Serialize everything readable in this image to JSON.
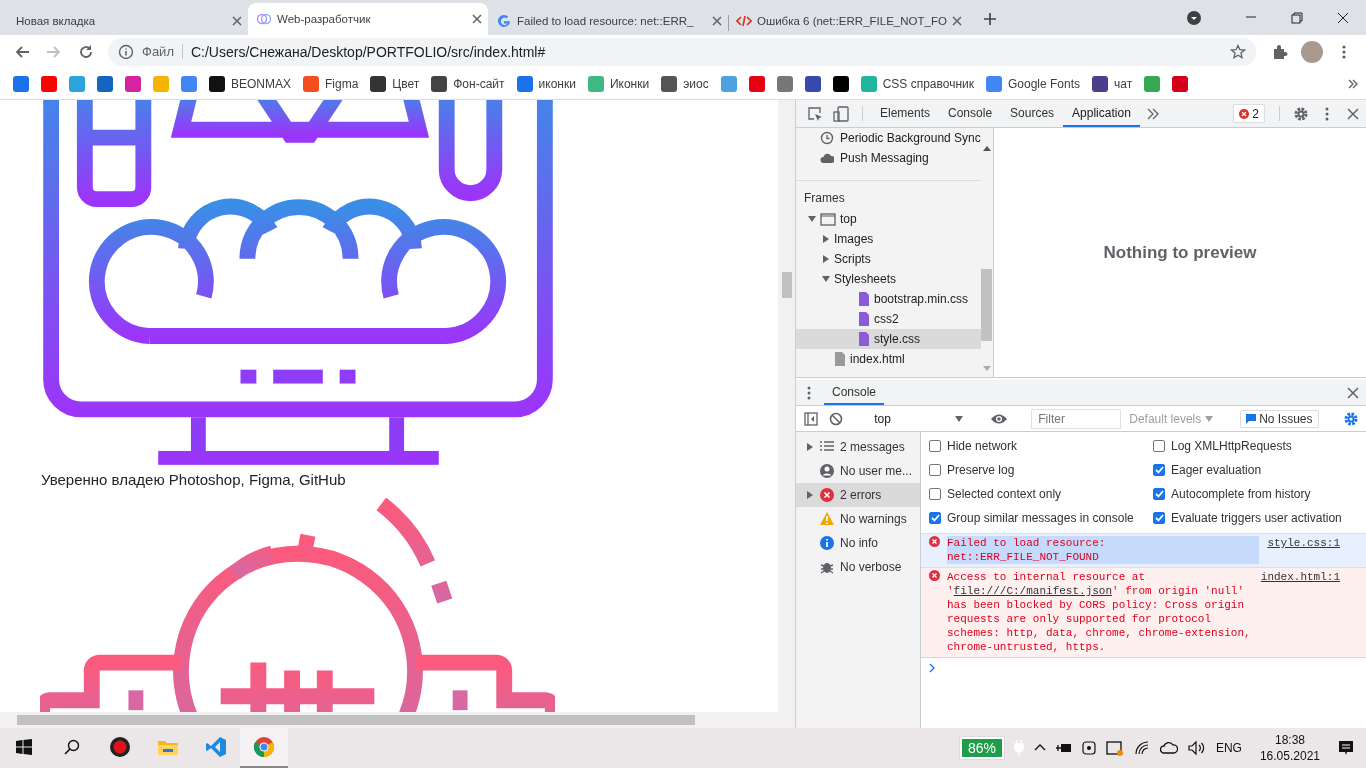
{
  "browser_tabs": [
    {
      "title": "Новая вкладка",
      "kind": "blank",
      "selected": false
    },
    {
      "title": "Web-разработчик",
      "kind": "site",
      "selected": true
    },
    {
      "title": "Failed to load resource: net::ERR_",
      "kind": "google",
      "selected": false
    },
    {
      "title": "Ошибка 6 (net::ERR_FILE_NOT_FO",
      "kind": "code",
      "selected": false
    }
  ],
  "address_bar": {
    "scheme_label": "Файл",
    "url": "C:/Users/Снежана/Desktop/PORTFOLIO/src/index.html#"
  },
  "bookmarks": [
    {
      "color": "#1a73e8"
    },
    {
      "color": "#ff0000"
    },
    {
      "color": "#2aa3df"
    },
    {
      "color": "#1565c0"
    },
    {
      "color": "#d6249f"
    },
    {
      "color": "#f4b400"
    },
    {
      "color": "#4285f4"
    },
    {
      "label": "BEONMAX",
      "color": "#111111"
    },
    {
      "label": "Figma",
      "color": "#f24e1e"
    },
    {
      "label": "Цвет",
      "color": "#333333"
    },
    {
      "label": "Фон-сайт",
      "color": "#444444"
    },
    {
      "label": "иконки",
      "color": "#1a73e8"
    },
    {
      "label": "Иконки",
      "color": "#3fb984"
    },
    {
      "label": "эиос",
      "color": "#555555"
    },
    {
      "color": "#4aa3df"
    },
    {
      "color": "#e60012"
    },
    {
      "color": "#777777"
    },
    {
      "color": "#3949ab"
    },
    {
      "color": "#000000"
    },
    {
      "label": "CSS справочник",
      "color": "#21b5a0"
    },
    {
      "label": "Google Fonts",
      "color": "#4285f4"
    },
    {
      "label": "чат",
      "color": "#4b3f8c"
    },
    {
      "color": "#34a853"
    },
    {
      "color": "#d6001c"
    }
  ],
  "page": {
    "skills_text": "Уверенно владею Photoshop, Figma, GitHub"
  },
  "devtools": {
    "tabs": [
      {
        "label": "Elements",
        "selected": false
      },
      {
        "label": "Console",
        "selected": false
      },
      {
        "label": "Sources",
        "selected": false
      },
      {
        "label": "Application",
        "selected": true
      }
    ],
    "error_count": "2",
    "background_services": [
      {
        "label": "Periodic Background Sync",
        "kind": "clock"
      },
      {
        "label": "Push Messaging",
        "kind": "cloud"
      }
    ],
    "frames_heading": "Frames",
    "frames": [
      {
        "label": "top",
        "kind": "frame",
        "expanded": true,
        "selected": false,
        "children": [
          {
            "label": "Images",
            "kind": "folder",
            "expanded": false,
            "selected": false
          },
          {
            "label": "Scripts",
            "kind": "folder",
            "expanded": false,
            "selected": false
          },
          {
            "label": "Stylesheets",
            "kind": "folder",
            "expanded": true,
            "selected": false,
            "children": [
              {
                "label": "bootstrap.min.css",
                "kind": "stylesheet",
                "selected": false
              },
              {
                "label": "css2",
                "kind": "stylesheet",
                "selected": false
              },
              {
                "label": "style.css",
                "kind": "stylesheet",
                "selected": true
              }
            ]
          },
          {
            "label": "index.html",
            "kind": "document",
            "selected": false
          }
        ]
      }
    ],
    "preview_text": "Nothing to preview",
    "drawer_tab": "Console",
    "console": {
      "context": "top",
      "filter_placeholder": "Filter",
      "levels": "Default levels",
      "issues": "No Issues",
      "sidebar": [
        {
          "label": "2 messages",
          "kind": "messages",
          "expandable": true,
          "selected": false
        },
        {
          "label": "No user me...",
          "kind": "user",
          "expandable": false,
          "selected": false
        },
        {
          "label": "2 errors",
          "kind": "errors",
          "expandable": true,
          "selected": true
        },
        {
          "label": "No warnings",
          "kind": "warnings",
          "expandable": false,
          "selected": false
        },
        {
          "label": "No info",
          "kind": "info",
          "expandable": false,
          "selected": false
        },
        {
          "label": "No verbose",
          "kind": "verbose",
          "expandable": false,
          "selected": false
        }
      ],
      "settings": [
        {
          "label": "Hide network",
          "checked": false
        },
        {
          "label": "Log XMLHttpRequests",
          "checked": false
        },
        {
          "label": "Preserve log",
          "checked": false
        },
        {
          "label": "Eager evaluation",
          "checked": true
        },
        {
          "label": "Selected context only",
          "checked": false
        },
        {
          "label": "Autocomplete from history",
          "checked": true
        },
        {
          "label": "Group similar messages in console",
          "checked": true
        },
        {
          "label": "Evaluate triggers user activation",
          "checked": true
        }
      ],
      "messages": [
        {
          "kind": "error",
          "text": "Failed to load resource: net::ERR_FILE_NOT_FOUND",
          "source": "style.css:1",
          "text_selected": true
        },
        {
          "kind": "error",
          "text": "Access to internal resource at '",
          "link": "file:///C:/manifest.json",
          "text_after": "' from origin 'null' has been blocked by CORS policy: Cross origin requests are only supported for protocol schemes: http, data, chrome, chrome-extension, chrome-untrusted, https.",
          "source": "index.html:1",
          "text_selected": false
        }
      ]
    }
  },
  "taskbar": {
    "apps": [
      {
        "kind": "recorder",
        "active": false
      },
      {
        "kind": "explorer",
        "active": false
      },
      {
        "kind": "vscode",
        "active": false
      },
      {
        "kind": "chrome",
        "active": true
      }
    ],
    "battery": "86%",
    "language": "ENG",
    "time": "18:38",
    "date": "16.05.2021"
  }
}
